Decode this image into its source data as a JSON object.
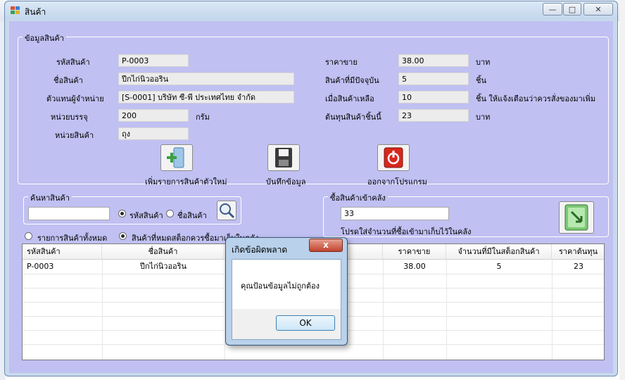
{
  "window": {
    "title": "สินค้า",
    "controls": {
      "minimize": "—",
      "maximize": "□",
      "close": "✕"
    }
  },
  "product_info": {
    "group_title": "ข้อมูลสินค้า",
    "fields": {
      "code": {
        "label": "รหัสสินค้า",
        "value": "P-0003"
      },
      "name": {
        "label": "ชื่อสินค้า",
        "value": "ปีกไก่นิวออริน"
      },
      "supplier": {
        "label": "ตัวแทนผู้จำหน่าย",
        "value": "[S-0001] บริษัท ซี-พี ประเทศไทย จำกัด"
      },
      "pack_unit": {
        "label": "หน่วยบรรจุ",
        "value": "200",
        "unit": "กรัม"
      },
      "unit": {
        "label": "หน่วยสินค้า",
        "value": "ถุง"
      },
      "price": {
        "label": "ราคาขาย",
        "value": "38.00",
        "unit": "บาท"
      },
      "stock": {
        "label": "สินค้าที่มีปัจจุบัน",
        "value": "5",
        "unit": "ชิ้น"
      },
      "reorder": {
        "label": "เมื่อสินค้าเหลือ",
        "value": "10",
        "unit": "ชิ้น ให้แจ้งเตือนว่าควรสั่งของมาเพิ่ม"
      },
      "cost": {
        "label": "ต้นทุนสินค้าชิ้นนี้",
        "value": "23",
        "unit": "บาท"
      }
    },
    "buttons": {
      "add": "เพิ่มรายการสินค้าตัวใหม่",
      "save": "บันทึกข้อมูล",
      "exit": "ออกจากโปรแกรม"
    }
  },
  "search": {
    "group_title": "ค้นหาสินค้า",
    "input_value": "",
    "options": {
      "by_code": "รหัสสินค้า",
      "by_name": "ชื่อสินค้า"
    },
    "selected": "by_code"
  },
  "filters": {
    "all": "รายการสินค้าทั้งหมด",
    "low_stock": "สินค้าที่หมดสต็อกควรซื้อมาเก็บในคลัง",
    "selected": "low_stock"
  },
  "buy_in": {
    "group_title": "ซื้อสินค้าเข้าคลัง",
    "quantity": "33",
    "hint": "โปรดใส่จำนวนที่ซื้อเข้ามาเก็บไว้ในคลัง"
  },
  "table": {
    "columns": [
      "รหัสสินค้า",
      "ชื่อสินค้า",
      "",
      "ราคาขาย",
      "จำนวนที่มีในสต็อกสินค้า",
      "ราคาต้นทุน"
    ],
    "rows": [
      [
        "P-0003",
        "ปีกไก่นิวออริน",
        "",
        "38.00",
        "5",
        "23"
      ]
    ]
  },
  "dialog": {
    "title": "เกิดข้อผิดพลาด",
    "close": "x",
    "message": "คุณป้อนข้อมูลไม่ถูกต้อง",
    "ok": "OK"
  },
  "colors": {
    "form_bg": "#c0c0f2",
    "dialog_frame": "#b9d1ea",
    "close_red": "#c0442e"
  }
}
